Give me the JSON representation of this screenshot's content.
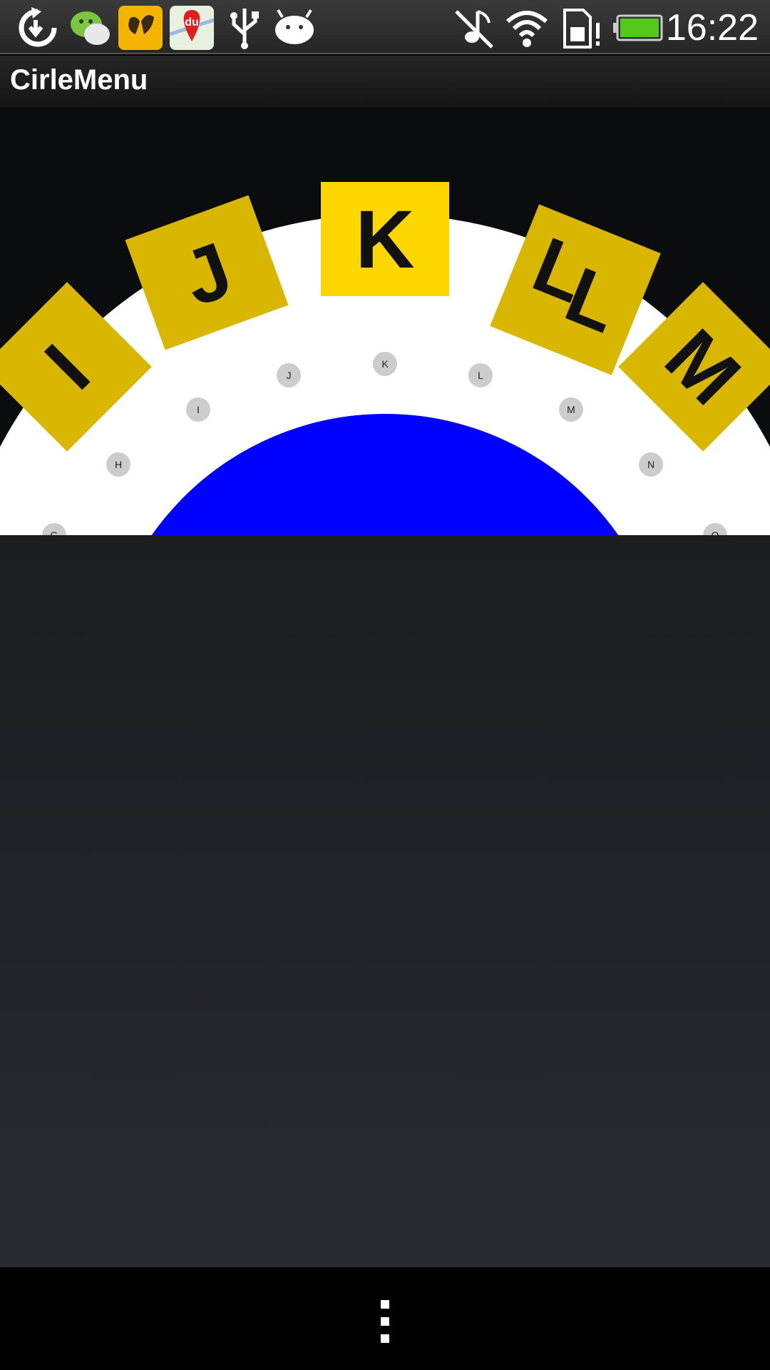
{
  "statusbar": {
    "time": "16:22",
    "icons": [
      "sync-icon",
      "wechat-icon",
      "butterfly-app-icon",
      "baidu-maps-icon",
      "usb-icon",
      "android-debug-icon",
      "mute-icon",
      "wifi-icon",
      "sim-alert-icon",
      "battery-icon"
    ],
    "baidu_label": "du"
  },
  "app": {
    "title": "CirleMenu"
  },
  "colors": {
    "tile_yellow": "#d9b700",
    "tile_yellow_active": "#ffd700",
    "ring": "#ffffff",
    "center": "#0000ff",
    "dot": "#cccccc"
  },
  "circle_menu": {
    "tiles": [
      "I",
      "J",
      "K",
      "L",
      "M"
    ],
    "tile_l_extra": "L",
    "inner_dots": [
      "G",
      "H",
      "I",
      "J",
      "K",
      "L",
      "M",
      "N",
      "O"
    ],
    "active": "K"
  },
  "navbar": {
    "menu_icon": "overflow-menu-icon"
  }
}
